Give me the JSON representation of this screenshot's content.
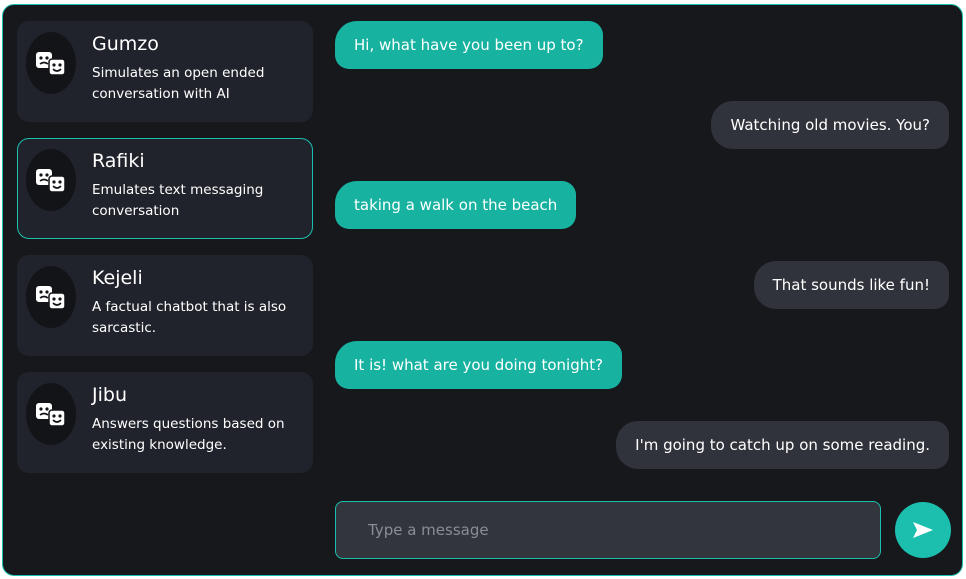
{
  "bots": [
    {
      "name": "Gumzo",
      "description": "Simulates an open ended conversation with AI",
      "icon": "theater-masks-icon"
    },
    {
      "name": "Rafiki",
      "description": "Emulates text messaging conversation",
      "icon": "theater-masks-icon",
      "active": true
    },
    {
      "name": "Kejeli",
      "description": "A factual chatbot that is also sarcastic.",
      "icon": "theater-masks-icon"
    },
    {
      "name": "Jibu",
      "description": "Answers questions based on existing knowledge.",
      "icon": "theater-masks-icon"
    }
  ],
  "messages": [
    {
      "from": "bot",
      "text": "Hi, what have you been up to?"
    },
    {
      "from": "user",
      "text": "Watching old movies. You?"
    },
    {
      "from": "bot",
      "text": "taking a walk on the beach"
    },
    {
      "from": "user",
      "text": "That sounds like fun!"
    },
    {
      "from": "bot",
      "text": "It is! what are you doing tonight?"
    },
    {
      "from": "user",
      "text": "I'm going to catch up on some reading."
    }
  ],
  "composer": {
    "placeholder": "Type a message",
    "value": ""
  },
  "send_icon": "send-icon",
  "colors": {
    "accent": "#1cbfae",
    "background": "#16181c",
    "card": "#20232b",
    "user_bubble": "#30333b"
  }
}
